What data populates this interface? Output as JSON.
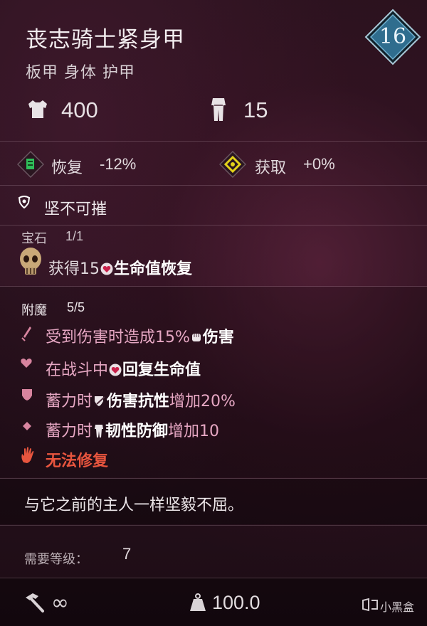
{
  "item": {
    "name": "丧志骑士紧身甲",
    "type": "板甲 身体 护甲",
    "level": "16"
  },
  "stats": {
    "armor": "400",
    "weight": "15"
  },
  "bonuses": {
    "recovery_label": "恢复",
    "recovery_value": "-12%",
    "gain_label": "获取",
    "gain_value": "+0%"
  },
  "trait": {
    "label": "坚不可摧"
  },
  "gem": {
    "header": "宝石",
    "count": "1/1",
    "text_prefix": "获得15",
    "text_bold": "生命值恢复"
  },
  "enchant": {
    "header": "附魔",
    "count": "5/5",
    "lines": [
      {
        "prefix": "受到伤害时造成15%",
        "bold": "伤害",
        "suffix": ""
      },
      {
        "prefix": "在战斗中",
        "bold": "回复生命值",
        "suffix": ""
      },
      {
        "prefix": "蓄力时",
        "bold": "伤害抗性",
        "suffix": "增加20%"
      },
      {
        "prefix": "蓄力时",
        "bold": "韧性防御",
        "suffix": "增加10"
      }
    ],
    "curse": "无法修复"
  },
  "flavor": "与它之前的主人一样坚毅不屈。",
  "requirement": {
    "label": "需要等级：",
    "value": "7"
  },
  "footer": {
    "durability": "∞",
    "weight": "100.0",
    "watermark": "小黑盒"
  },
  "colors": {
    "recovery_icon": "#2fbf5a",
    "gain_icon": "#e2d21a",
    "level_badge": "#2f6d8e",
    "curse": "#e8553e"
  }
}
